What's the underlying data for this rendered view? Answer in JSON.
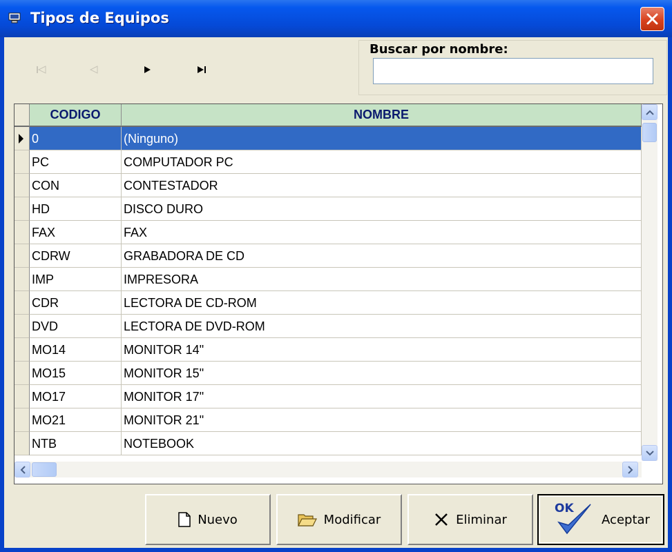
{
  "window": {
    "title": "Tipos de Equipos"
  },
  "search": {
    "label": "Buscar por nombre:",
    "value": ""
  },
  "grid": {
    "columns": [
      "CODIGO",
      "NOMBRE"
    ],
    "rows": [
      {
        "codigo": "0",
        "nombre": "(Ninguno)",
        "selected": true
      },
      {
        "codigo": "PC",
        "nombre": "COMPUTADOR PC"
      },
      {
        "codigo": "CON",
        "nombre": "CONTESTADOR"
      },
      {
        "codigo": "HD",
        "nombre": "DISCO DURO"
      },
      {
        "codigo": "FAX",
        "nombre": "FAX"
      },
      {
        "codigo": "CDRW",
        "nombre": "GRABADORA DE CD"
      },
      {
        "codigo": "IMP",
        "nombre": "IMPRESORA"
      },
      {
        "codigo": "CDR",
        "nombre": "LECTORA DE CD-ROM"
      },
      {
        "codigo": "DVD",
        "nombre": "LECTORA DE DVD-ROM"
      },
      {
        "codigo": "MO14",
        "nombre": "MONITOR 14\""
      },
      {
        "codigo": "MO15",
        "nombre": "MONITOR 15\""
      },
      {
        "codigo": "MO17",
        "nombre": "MONITOR 17\""
      },
      {
        "codigo": "MO21",
        "nombre": "MONITOR 21\""
      },
      {
        "codigo": "NTB",
        "nombre": "NOTEBOOK"
      }
    ]
  },
  "buttons": {
    "nuevo": "Nuevo",
    "modificar": "Modificar",
    "eliminar": "Eliminar",
    "aceptar": "Aceptar",
    "ok_mark": "OK"
  },
  "colors": {
    "titlebar": "#0658ee",
    "selection": "#316ac5",
    "header": "#c6e3c6"
  }
}
